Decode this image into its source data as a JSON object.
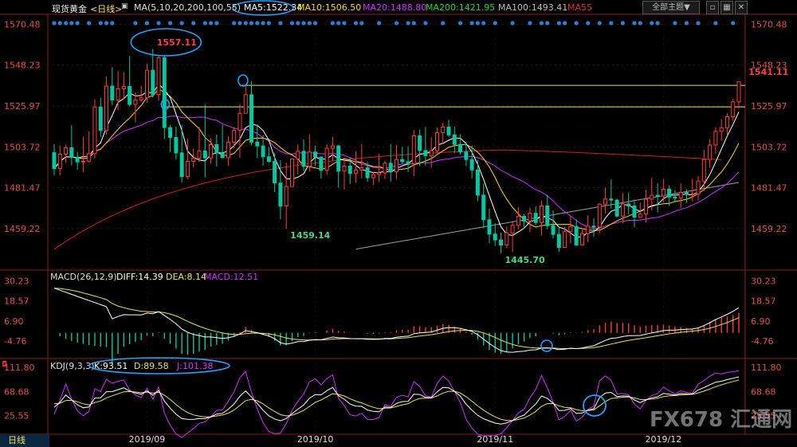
{
  "header": {
    "symbol": "现货黄金",
    "period_tag": "<日线>",
    "ma_label": "MA(5,10,20,200,100,55)",
    "ma5": "MA5:1522.34",
    "ma10": "MA10:1506.50",
    "ma20": "MA20:1488.80",
    "ma200": "MA200:1421.95",
    "ma100": "MA100:1493.41",
    "ma55": "MA55",
    "theme_button": "全部主题▼"
  },
  "footer": {
    "period": "日线"
  },
  "watermark": "FX678 汇通网",
  "colors": {
    "background": "#000000",
    "up": "#ff3c3c",
    "down": "#00c8a0",
    "ma5": "#ffffff",
    "ma10": "#ffd700",
    "ma20": "#d030ff",
    "ma200": "#9e9e9e",
    "ma55": "#d02020",
    "hline": "#e6e64b",
    "circle": "#1aa3ff",
    "diff": "#ffffff",
    "dea": "#e6e64b",
    "jline": "#d030ff"
  },
  "chart_data": [
    {
      "type": "candlestick",
      "title": "现货黄金 日线",
      "y_ticks": [
        1570.48,
        1548.23,
        1525.97,
        1503.72,
        1481.47,
        1459.22
      ],
      "ylim": [
        1437,
        1575
      ],
      "x_labels": [
        {
          "label": "2019/09",
          "index": 16
        },
        {
          "label": "2019/10",
          "index": 45
        },
        {
          "label": "2019/11",
          "index": 76
        },
        {
          "label": "2019/12",
          "index": 105
        }
      ],
      "candles_ohlc": [
        [
          1500.5,
          1505.2,
          1488.1,
          1491.8
        ],
        [
          1491.8,
          1504.3,
          1488.2,
          1499.7
        ],
        [
          1499.7,
          1504.9,
          1494.9,
          1503.2
        ],
        [
          1503.2,
          1515.3,
          1493.7,
          1498.0
        ],
        [
          1498.0,
          1501.0,
          1491.2,
          1495.5
        ],
        [
          1495.5,
          1509.3,
          1489.8,
          1495.9
        ],
        [
          1495.9,
          1512.1,
          1495.2,
          1500.0
        ],
        [
          1500.0,
          1529.6,
          1497.5,
          1525.4
        ],
        [
          1525.4,
          1530.5,
          1509.1,
          1512.6
        ],
        [
          1512.6,
          1541.9,
          1510.3,
          1536.8
        ],
        [
          1536.8,
          1547.1,
          1526.5,
          1529.2
        ],
        [
          1529.2,
          1545.0,
          1523.7,
          1535.3
        ],
        [
          1535.3,
          1544.5,
          1530.0,
          1536.6
        ],
        [
          1536.6,
          1553.1,
          1525.7,
          1526.8
        ],
        [
          1526.8,
          1533.4,
          1517.1,
          1529.3
        ],
        [
          1529.3,
          1537.1,
          1528.1,
          1530.4
        ],
        [
          1530.4,
          1549.1,
          1527.8,
          1545.4
        ],
        [
          1545.4,
          1557.1,
          1530.6,
          1532.1
        ],
        [
          1532.1,
          1553.4,
          1528.8,
          1552.2
        ],
        [
          1552.2,
          1553.3,
          1508.0,
          1514.2
        ],
        [
          1514.2,
          1515.7,
          1500.9,
          1508.8
        ],
        [
          1508.8,
          1514.8,
          1496.8,
          1500.4
        ],
        [
          1500.4,
          1515.6,
          1484.1,
          1487.5
        ],
        [
          1487.5,
          1508.3,
          1486.2,
          1495.8
        ],
        [
          1495.8,
          1502.9,
          1492.6,
          1497.6
        ],
        [
          1497.6,
          1514.6,
          1495.6,
          1501.5
        ],
        [
          1501.5,
          1526.7,
          1486.9,
          1497.7
        ],
        [
          1497.7,
          1508.4,
          1494.6,
          1504.9
        ],
        [
          1504.9,
          1510.4,
          1493.0,
          1500.3
        ],
        [
          1500.3,
          1515.7,
          1497.9,
          1497.8
        ],
        [
          1497.8,
          1509.4,
          1493.3,
          1506.2
        ],
        [
          1506.2,
          1514.4,
          1502.8,
          1512.7
        ],
        [
          1512.7,
          1526.9,
          1497.8,
          1522.0
        ],
        [
          1522.0,
          1537.7,
          1522.6,
          1532.1
        ],
        [
          1532.1,
          1539.6,
          1504.5,
          1506.3
        ],
        [
          1506.3,
          1515.8,
          1497.6,
          1504.2
        ],
        [
          1504.2,
          1510.0,
          1493.5,
          1498.3
        ],
        [
          1498.3,
          1503.7,
          1495.0,
          1495.8
        ],
        [
          1495.8,
          1500.6,
          1479.1,
          1484.0
        ],
        [
          1484.0,
          1496.4,
          1464.3,
          1471.5
        ],
        [
          1471.5,
          1495.1,
          1459.1,
          1482.1
        ],
        [
          1482.1,
          1497.4,
          1481.9,
          1497.1
        ],
        [
          1497.1,
          1505.1,
          1488.6,
          1501.3
        ],
        [
          1501.3,
          1507.7,
          1490.6,
          1493.1
        ],
        [
          1493.1,
          1510.5,
          1490.4,
          1500.9
        ],
        [
          1500.9,
          1504.3,
          1493.2,
          1498.2
        ],
        [
          1498.2,
          1498.4,
          1486.4,
          1490.9
        ],
        [
          1490.9,
          1505.0,
          1488.5,
          1502.9
        ],
        [
          1502.9,
          1509.1,
          1496.0,
          1504.2
        ],
        [
          1504.2,
          1504.8,
          1481.4,
          1490.5
        ],
        [
          1490.5,
          1497.7,
          1480.5,
          1493.2
        ],
        [
          1493.2,
          1498.0,
          1483.5,
          1489.2
        ],
        [
          1489.2,
          1501.4,
          1484.1,
          1491.1
        ],
        [
          1491.1,
          1505.3,
          1486.4,
          1492.3
        ],
        [
          1492.3,
          1495.3,
          1484.7,
          1486.9
        ],
        [
          1486.9,
          1490.2,
          1482.8,
          1488.6
        ],
        [
          1488.6,
          1499.9,
          1484.5,
          1489.5
        ],
        [
          1489.5,
          1496.2,
          1486.2,
          1494.8
        ],
        [
          1494.8,
          1505.2,
          1484.8,
          1490.1
        ],
        [
          1490.1,
          1504.6,
          1486.2,
          1496.8
        ],
        [
          1496.8,
          1503.7,
          1494.6,
          1495.6
        ],
        [
          1495.6,
          1504.0,
          1490.0,
          1494.5
        ],
        [
          1494.5,
          1512.9,
          1487.7,
          1509.7
        ],
        [
          1509.7,
          1513.0,
          1493.2,
          1501.7
        ],
        [
          1501.7,
          1514.5,
          1493.3,
          1498.9
        ],
        [
          1498.9,
          1509.0,
          1492.3,
          1501.6
        ],
        [
          1501.6,
          1514.4,
          1499.5,
          1511.4
        ],
        [
          1511.4,
          1517.0,
          1506.2,
          1514.5
        ],
        [
          1514.5,
          1518.3,
          1509.2,
          1510.2
        ],
        [
          1510.2,
          1514.7,
          1500.3,
          1505.0
        ],
        [
          1505.0,
          1510.6,
          1499.4,
          1500.9
        ],
        [
          1500.9,
          1506.5,
          1493.3,
          1496.8
        ],
        [
          1496.8,
          1504.4,
          1486.6,
          1491.1
        ],
        [
          1491.1,
          1496.6,
          1474.1,
          1477.4
        ],
        [
          1477.4,
          1483.8,
          1459.5,
          1464.0
        ],
        [
          1464.0,
          1470.1,
          1451.2,
          1456.2
        ],
        [
          1456.2,
          1462.2,
          1449.7,
          1453.0
        ],
        [
          1453.0,
          1457.0,
          1445.7,
          1450.2
        ],
        [
          1450.2,
          1460.3,
          1448.5,
          1456.8
        ],
        [
          1456.8,
          1463.2,
          1446.3,
          1460.9
        ],
        [
          1460.9,
          1471.0,
          1458.8,
          1465.9
        ],
        [
          1465.9,
          1467.2,
          1459.0,
          1463.2
        ],
        [
          1463.2,
          1470.6,
          1457.1,
          1467.5
        ],
        [
          1467.5,
          1471.4,
          1461.0,
          1462.5
        ],
        [
          1462.5,
          1474.5,
          1455.5,
          1471.5
        ],
        [
          1471.5,
          1477.5,
          1458.8,
          1460.8
        ],
        [
          1460.8,
          1469.1,
          1453.9,
          1456.0
        ],
        [
          1456.0,
          1460.5,
          1446.5,
          1448.9
        ],
        [
          1448.9,
          1460.2,
          1449.3,
          1457.5
        ],
        [
          1457.5,
          1466.2,
          1451.1,
          1460.3
        ],
        [
          1460.3,
          1464.2,
          1449.8,
          1450.2
        ],
        [
          1450.2,
          1458.7,
          1450.2,
          1456.5
        ],
        [
          1456.5,
          1466.4,
          1451.7,
          1460.5
        ],
        [
          1460.5,
          1464.8,
          1454.7,
          1460.0
        ],
        [
          1460.0,
          1473.0,
          1456.5,
          1472.5
        ],
        [
          1472.5,
          1481.5,
          1467.3,
          1475.3
        ],
        [
          1475.3,
          1486.0,
          1470.1,
          1474.7
        ],
        [
          1474.7,
          1475.4,
          1465.3,
          1466.0
        ],
        [
          1466.0,
          1478.6,
          1462.2,
          1472.6
        ],
        [
          1472.6,
          1478.8,
          1467.0,
          1471.5
        ],
        [
          1471.5,
          1475.0,
          1459.8,
          1465.4
        ],
        [
          1465.4,
          1473.2,
          1465.1,
          1467.1
        ],
        [
          1467.1,
          1480.3,
          1462.6,
          1475.2
        ],
        [
          1475.2,
          1486.8,
          1469.1,
          1477.3
        ],
        [
          1477.3,
          1483.9,
          1468.1,
          1476.9
        ],
        [
          1476.9,
          1486.2,
          1473.5,
          1480.6
        ],
        [
          1480.6,
          1482.8,
          1471.5,
          1476.4
        ],
        [
          1476.4,
          1480.1,
          1473.5,
          1475.8
        ],
        [
          1475.8,
          1483.7,
          1470.4,
          1478.8
        ],
        [
          1478.8,
          1480.7,
          1473.2,
          1478.0
        ],
        [
          1478.0,
          1486.3,
          1474.1,
          1478.1
        ],
        [
          1478.1,
          1487.9,
          1474.5,
          1485.1
        ],
        [
          1485.1,
          1502.1,
          1479.7,
          1496.8
        ],
        [
          1496.8,
          1508.1,
          1492.3,
          1504.7
        ],
        [
          1504.7,
          1514.4,
          1499.9,
          1512.2
        ],
        [
          1512.2,
          1518.8,
          1507.0,
          1514.1
        ],
        [
          1514.1,
          1522.0,
          1510.3,
          1520.1
        ],
        [
          1520.1,
          1529.8,
          1517.7,
          1528.2
        ],
        [
          1528.2,
          1539.2,
          1524.5,
          1539.1
        ]
      ],
      "moving_averages": [
        {
          "name": "MA5",
          "value": 1522.34
        },
        {
          "name": "MA10",
          "value": 1506.5
        },
        {
          "name": "MA20",
          "value": 1488.8
        },
        {
          "name": "MA200",
          "value": 1421.95
        },
        {
          "name": "MA100",
          "value": 1493.41
        },
        {
          "name": "MA55",
          "value": null
        }
      ],
      "horizontal_lines": [
        1537.2,
        1525.5
      ],
      "price_annotations": [
        {
          "text": "1557.11",
          "index": 17,
          "price": 1557.11,
          "position": "high"
        },
        {
          "text": "1459.14",
          "index": 40,
          "price": 1459.14,
          "position": "low"
        },
        {
          "text": "1445.70",
          "index": 77,
          "price": 1445.7,
          "position": "low"
        },
        {
          "text": "1541.11",
          "index": 119,
          "price": 1541.11,
          "position": "high"
        }
      ]
    },
    {
      "type": "macd",
      "title": "MACD(26,12,9)",
      "labels": {
        "name": "MACD(26,12,9)",
        "diff": "DIFF:14.39",
        "dea": "DEA:8.14",
        "macd": "MACD:12.51"
      },
      "y_ticks": [
        30.23,
        18.57,
        6.9,
        -4.76
      ],
      "ylim": [
        -14,
        36
      ],
      "diff_last": 14.39,
      "dea_last": 8.14,
      "macd_last": 12.51
    },
    {
      "type": "kdj",
      "title": "KDJ(9,3,3)",
      "labels": {
        "name": "KDJ(9,3,3)",
        "k": "K:93.51",
        "d": "D:89.58",
        "j": "J:101.38"
      },
      "y_ticks": [
        111.8,
        68.68,
        25.55
      ],
      "ylim": [
        -5,
        125
      ],
      "k_last": 93.51,
      "d_last": 89.58,
      "j_last": 101.38
    }
  ]
}
